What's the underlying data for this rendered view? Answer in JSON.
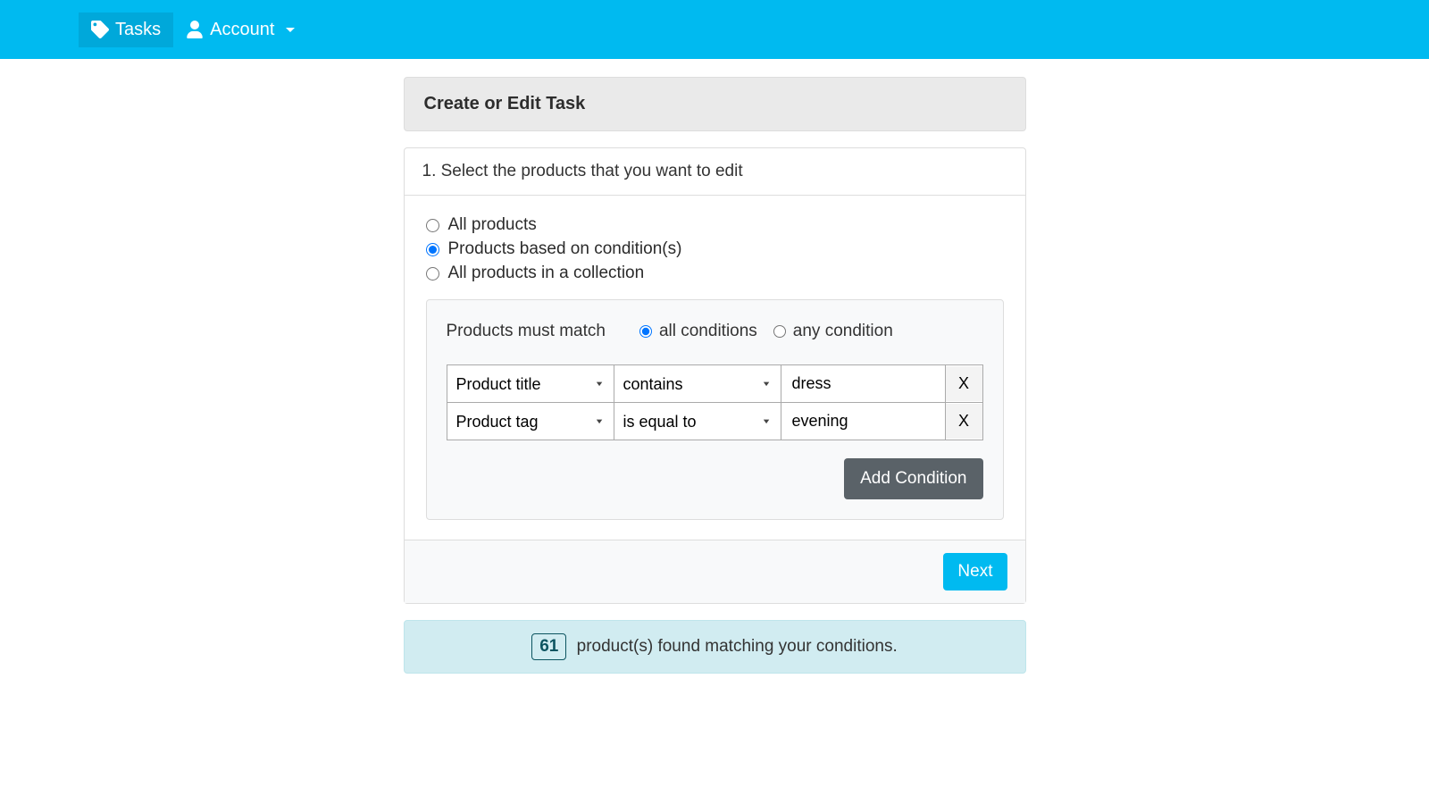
{
  "nav": {
    "tasks": "Tasks",
    "account": "Account"
  },
  "header": {
    "title": "Create or Edit Task"
  },
  "step": {
    "title": "1. Select the products that you want to edit"
  },
  "selection": {
    "options": [
      "All products",
      "Products based on condition(s)",
      "All products in a collection"
    ],
    "selected_index": 1
  },
  "conditions": {
    "match_label": "Products must match",
    "match_options": [
      "all conditions",
      "any condition"
    ],
    "match_selected": 0,
    "rows": [
      {
        "field": "Product title",
        "operator": "contains",
        "value": "dress",
        "remove": "X"
      },
      {
        "field": "Product tag",
        "operator": "is equal to",
        "value": "evening",
        "remove": "X"
      }
    ],
    "add_label": "Add Condition"
  },
  "footer": {
    "next": "Next"
  },
  "result": {
    "count": "61",
    "text": "product(s) found matching your conditions."
  }
}
